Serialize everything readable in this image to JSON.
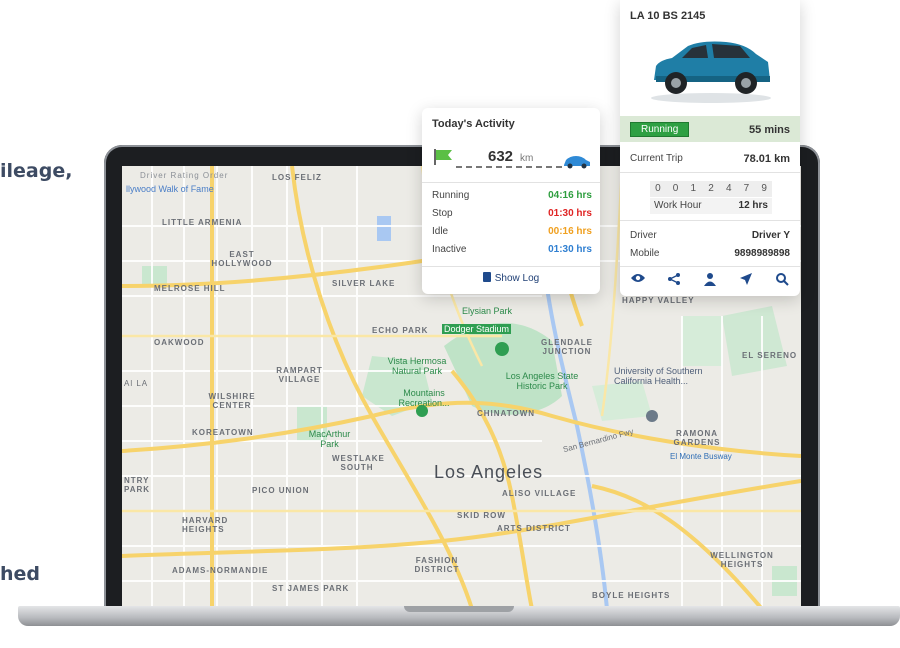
{
  "side_texts": {
    "line1": "ileage,",
    "line2": "hed"
  },
  "map": {
    "labels": [
      "Driver Rating Order",
      "LOS FELIZ",
      "LITTLE ARMENIA",
      "EAST HOLLYWOOD",
      "SILVER LAKE",
      "MELROSE HILL",
      "ECHO PARK",
      "OAKWOOD",
      "RAMPART VILLAGE",
      "WILSHIRE CENTER",
      "KOREATOWN",
      "WESTLAKE SOUTH",
      "CHINATOWN",
      "GLENDALE JUNCTION",
      "HAPPY VALLEY",
      "EL SERENO",
      "ALISO VILLAGE",
      "SKID ROW",
      "ARTS DISTRICT",
      "PICO UNION",
      "HARVARD HEIGHTS",
      "ADAMS-NORMANDIE",
      "ST JAMES PARK",
      "FASHION DISTRICT",
      "RAMONA GARDENS",
      "WELLINGTON HEIGHTS",
      "BOYLE HEIGHTS",
      "NTRY PARK",
      "Al LA"
    ],
    "city": "Los Angeles",
    "places": [
      "Elysian Park",
      "Dodger Stadium",
      "Vista Hermosa Natural Park",
      "Mountains Recreation...",
      "Los Angeles State Historic Park",
      "MacArthur Park",
      "University of Southern California Health...",
      "llywood Walk of Fame"
    ],
    "roads": [
      "El Monte Busway",
      "San Bernardino Fwy"
    ]
  },
  "activity": {
    "title": "Today's Activity",
    "distance_value": "632",
    "distance_unit": "km",
    "rows": [
      {
        "label": "Running",
        "value": "04:16 hrs",
        "color": "#2e9e3f"
      },
      {
        "label": "Stop",
        "value": "01:30 hrs",
        "color": "#e02424"
      },
      {
        "label": "Idle",
        "value": "00:16 hrs",
        "color": "#f0a020"
      },
      {
        "label": "Inactive",
        "value": "01:30 hrs",
        "color": "#2f7fd1"
      }
    ],
    "show_log": "Show Log"
  },
  "vehicle": {
    "plate": "LA 10 BS 2145",
    "status": "Running",
    "status_duration": "55 mins",
    "current_trip_label": "Current Trip",
    "current_trip_value": "78.01 km",
    "odometer": [
      "0",
      "0",
      "1",
      "2",
      "4",
      "7",
      "9"
    ],
    "work_hour_label": "Work Hour",
    "work_hour_value": "12 hrs",
    "driver_label": "Driver",
    "driver_value": "Driver Y",
    "mobile_label": "Mobile",
    "mobile_value": "9898989898",
    "actions": [
      "eye-icon",
      "share-icon",
      "driver-icon",
      "navigate-icon",
      "settings-icon"
    ]
  }
}
